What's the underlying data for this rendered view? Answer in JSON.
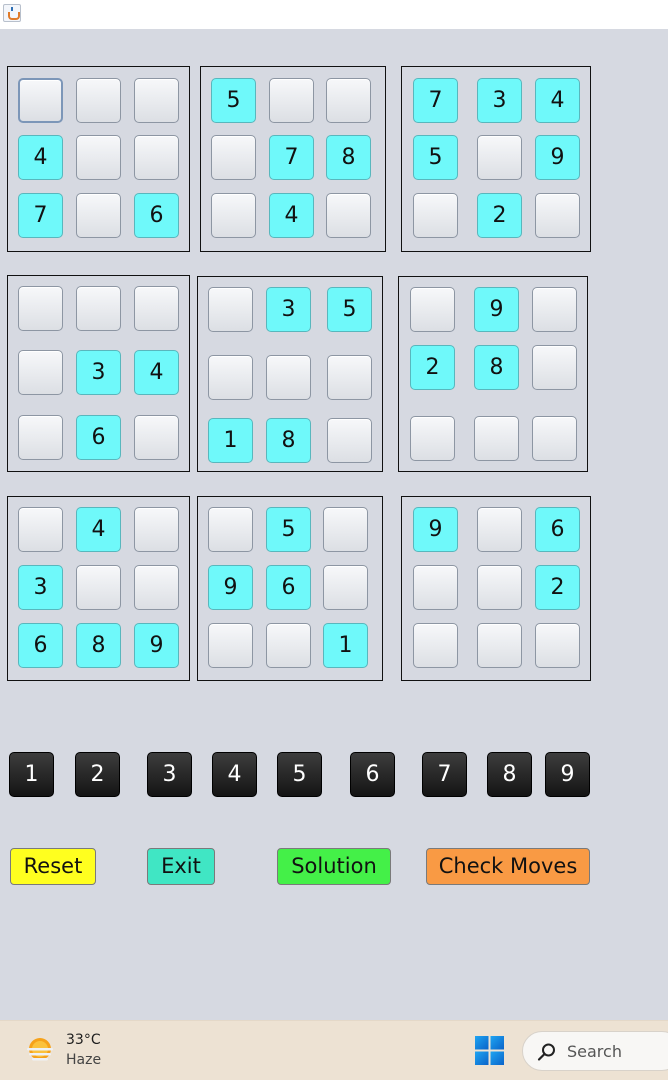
{
  "window": {
    "icon": "java-cup-icon"
  },
  "board": {
    "boxes": [
      {
        "cells": [
          "",
          "",
          "",
          "4",
          "",
          "",
          "7",
          "",
          "6"
        ],
        "given": [
          false,
          false,
          false,
          true,
          false,
          false,
          true,
          false,
          true
        ],
        "selected": 0
      },
      {
        "cells": [
          "5",
          "",
          "",
          "",
          "7",
          "8",
          "",
          "4",
          ""
        ],
        "given": [
          true,
          false,
          false,
          false,
          true,
          true,
          false,
          true,
          false
        ]
      },
      {
        "cells": [
          "7",
          "3",
          "4",
          "5",
          "",
          "9",
          "",
          "2",
          ""
        ],
        "given": [
          true,
          true,
          true,
          true,
          false,
          true,
          false,
          true,
          false
        ]
      },
      {
        "cells": [
          "",
          "",
          "",
          "",
          "3",
          "4",
          "",
          "6",
          ""
        ],
        "given": [
          false,
          false,
          false,
          false,
          true,
          true,
          false,
          true,
          false
        ]
      },
      {
        "cells": [
          "",
          "3",
          "5",
          "",
          "",
          "",
          "1",
          "8",
          ""
        ],
        "given": [
          false,
          true,
          true,
          false,
          false,
          false,
          true,
          true,
          false
        ]
      },
      {
        "cells": [
          "",
          "9",
          "",
          "2",
          "8",
          "",
          "",
          "",
          ""
        ],
        "given": [
          false,
          true,
          false,
          true,
          true,
          false,
          false,
          false,
          false
        ]
      },
      {
        "cells": [
          "",
          "4",
          "",
          "3",
          "",
          "",
          "6",
          "8",
          "9"
        ],
        "given": [
          false,
          true,
          false,
          true,
          false,
          false,
          true,
          true,
          true
        ]
      },
      {
        "cells": [
          "",
          "5",
          "",
          "9",
          "6",
          "",
          "",
          "",
          "1"
        ],
        "given": [
          false,
          true,
          false,
          true,
          true,
          false,
          false,
          false,
          true
        ]
      },
      {
        "cells": [
          "9",
          "",
          "6",
          "",
          "",
          "2",
          "",
          "",
          ""
        ],
        "given": [
          true,
          false,
          true,
          false,
          false,
          true,
          false,
          false,
          false
        ]
      }
    ]
  },
  "keypad": [
    "1",
    "2",
    "3",
    "4",
    "5",
    "6",
    "7",
    "8",
    "9"
  ],
  "actions": {
    "reset": "Reset",
    "exit": "Exit",
    "solution": "Solution",
    "check": "Check Moves"
  },
  "colors": {
    "given_cell": "#6ff9fa",
    "reset": "#ffff1f",
    "exit": "#40e6c4",
    "solution": "#44f048",
    "check": "#f99a44"
  },
  "taskbar": {
    "temperature": "33°C",
    "condition": "Haze",
    "weather_icon": "haze-sun-icon",
    "start_icon": "windows-start-icon",
    "search_label": "Search",
    "search_icon": "search-icon"
  }
}
